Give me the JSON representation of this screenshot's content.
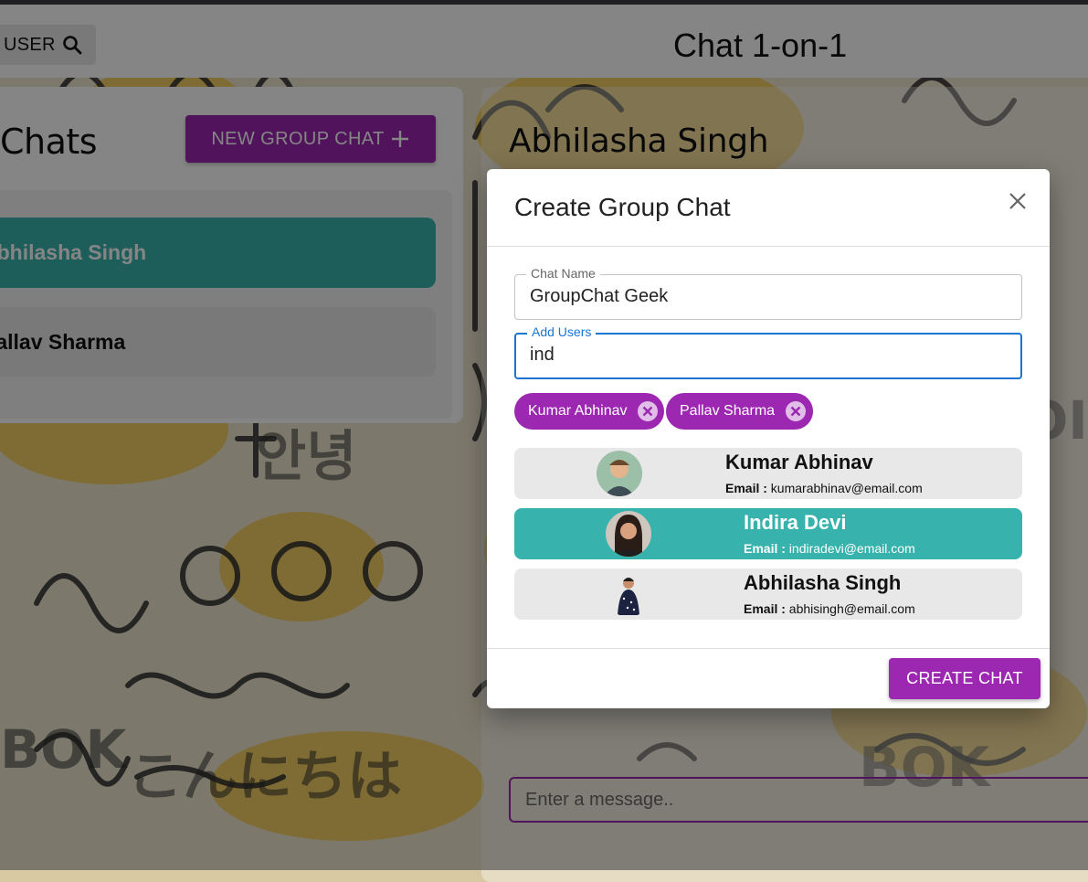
{
  "header": {
    "search_label": "USER",
    "title": "Chat 1-on-1"
  },
  "sidebar": {
    "title": "Chats",
    "new_group_label": "NEW GROUP CHAT",
    "chats": [
      {
        "label": "Abhilasha Singh",
        "active": true
      },
      {
        "label": "Pallav Sharma",
        "active": false
      }
    ]
  },
  "chat_area": {
    "partner_name": "Abhilasha Singh",
    "message_placeholder": "Enter a message.."
  },
  "modal": {
    "title": "Create Group Chat",
    "chat_name_label": "Chat Name",
    "chat_name_value": "GroupChat Geek",
    "add_users_label": "Add Users",
    "add_users_value": "ind",
    "selected_users": [
      "Kumar Abhinav",
      "Pallav Sharma"
    ],
    "email_prefix": "Email :",
    "results": [
      {
        "name": "Kumar Abhinav",
        "email": "kumarabhinav@email.com",
        "highlight": false
      },
      {
        "name": "Indira Devi",
        "email": "indiradevi@email.com",
        "highlight": true
      },
      {
        "name": "Abhilasha Singh",
        "email": "abhisingh@email.com",
        "highlight": false
      }
    ],
    "create_label": "CREATE CHAT"
  },
  "colors": {
    "accent": "#9c27b0",
    "teal": "#38b2ac",
    "focus": "#1976d2"
  }
}
